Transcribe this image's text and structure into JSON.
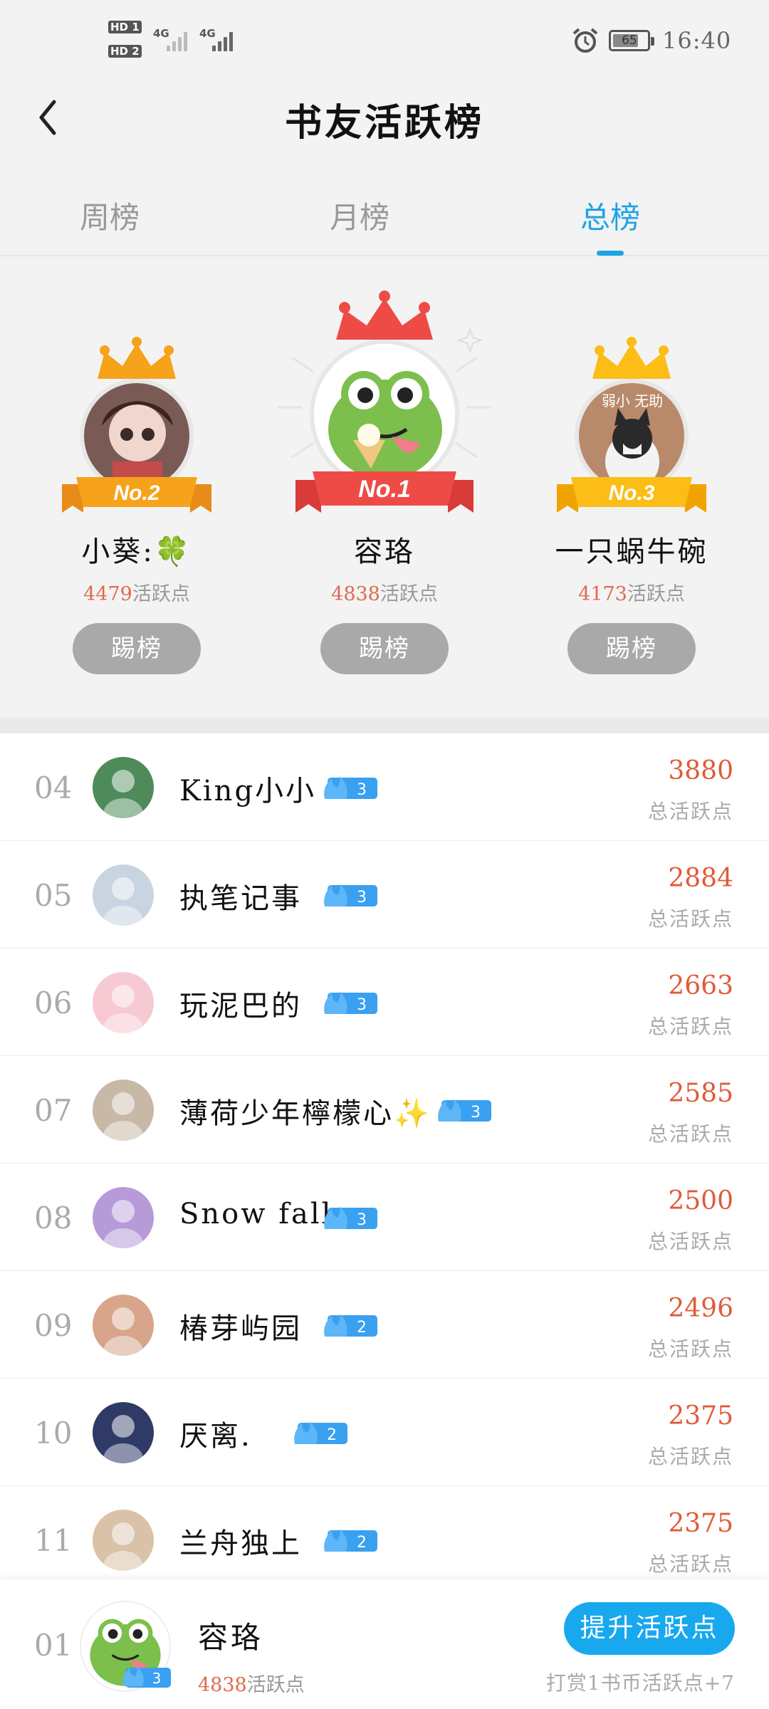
{
  "status_bar": {
    "sim1": "HD 1",
    "sim2": "HD 2",
    "net1": "4G",
    "net2": "4G",
    "battery": "65",
    "time": "16:40"
  },
  "header": {
    "title": "书友活跃榜"
  },
  "tabs": [
    {
      "label": "周榜",
      "active": false
    },
    {
      "label": "月榜",
      "active": false
    },
    {
      "label": "总榜",
      "active": true
    }
  ],
  "podium": {
    "first": {
      "rank": "No.1",
      "name": "容珞",
      "points": "4838",
      "points_label": "活跃点",
      "button": "踢榜"
    },
    "second": {
      "rank": "No.2",
      "name": "小葵:🍀",
      "points": "4479",
      "points_label": "活跃点",
      "button": "踢榜"
    },
    "third": {
      "rank": "No.3",
      "name": "一只蜗牛碗",
      "points": "4173",
      "points_label": "活跃点",
      "button": "踢榜",
      "avatar_caption": "弱小 无助"
    }
  },
  "list": [
    {
      "rank": "04",
      "name": "King小小",
      "level": "3",
      "score": "3880",
      "score_label": "总活跃点"
    },
    {
      "rank": "05",
      "name": "执笔记事",
      "level": "3",
      "score": "2884",
      "score_label": "总活跃点"
    },
    {
      "rank": "06",
      "name": "玩泥巴的",
      "level": "3",
      "score": "2663",
      "score_label": "总活跃点"
    },
    {
      "rank": "07",
      "name": "薄荷少年檸檬心✨",
      "level": "3",
      "score": "2585",
      "score_label": "总活跃点"
    },
    {
      "rank": "08",
      "name": "Snow fall",
      "level": "3",
      "score": "2500",
      "score_label": "总活跃点"
    },
    {
      "rank": "09",
      "name": "椿芽屿园",
      "level": "2",
      "score": "2496",
      "score_label": "总活跃点"
    },
    {
      "rank": "10",
      "name": "厌离.",
      "level": "2",
      "score": "2375",
      "score_label": "总活跃点"
    },
    {
      "rank": "11",
      "name": "兰舟独上",
      "level": "2",
      "score": "2375",
      "score_label": "总活跃点"
    }
  ],
  "footer": {
    "rank": "01",
    "name": "容珞",
    "level": "3",
    "points": "4838",
    "points_label": "活跃点",
    "boost_button": "提升活跃点",
    "hint": "打赏1书币活跃点+7"
  },
  "colors": {
    "accent": "#1fa3e4",
    "score": "#e05a38",
    "points": "#e0694e",
    "kick_button": "#a9a9a9",
    "boost_button": "#18a8ee"
  }
}
